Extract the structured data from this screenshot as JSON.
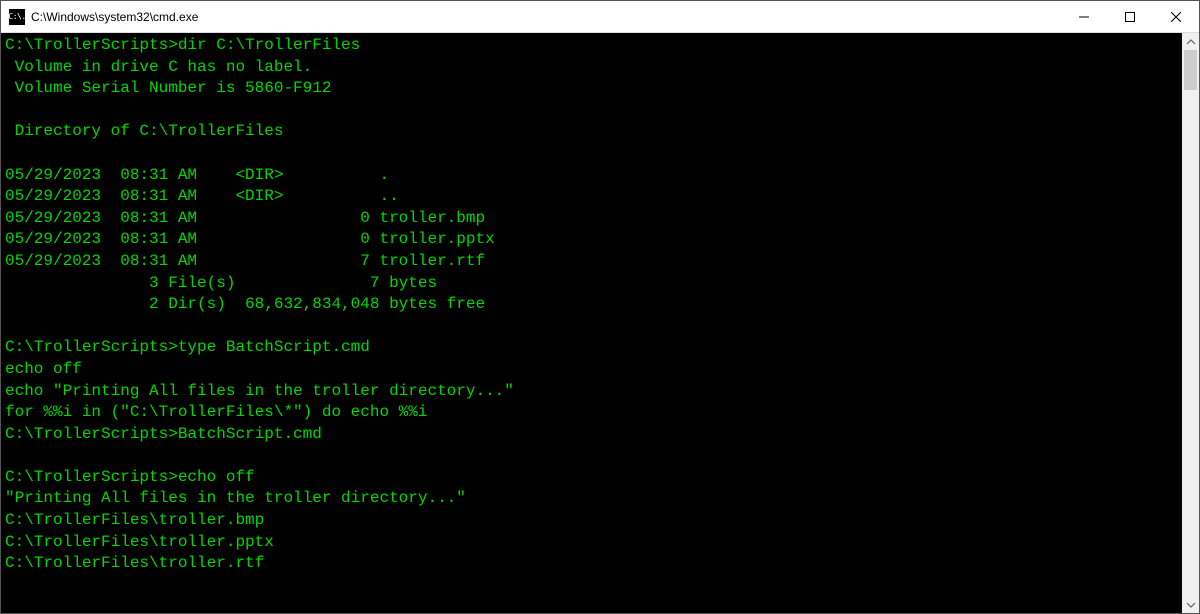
{
  "window": {
    "title": "C:\\Windows\\system32\\cmd.exe",
    "icon_text": "C:\\."
  },
  "terminal": {
    "lines": [
      "C:\\TrollerScripts>dir C:\\TrollerFiles",
      " Volume in drive C has no label.",
      " Volume Serial Number is 5860-F912",
      "",
      " Directory of C:\\TrollerFiles",
      "",
      "05/29/2023  08:31 AM    <DIR>          .",
      "05/29/2023  08:31 AM    <DIR>          ..",
      "05/29/2023  08:31 AM                 0 troller.bmp",
      "05/29/2023  08:31 AM                 0 troller.pptx",
      "05/29/2023  08:31 AM                 7 troller.rtf",
      "               3 File(s)              7 bytes",
      "               2 Dir(s)  68,632,834,048 bytes free",
      "",
      "C:\\TrollerScripts>type BatchScript.cmd",
      "echo off",
      "echo \"Printing All files in the troller directory...\"",
      "for %%i in (\"C:\\TrollerFiles\\*\") do echo %%i",
      "C:\\TrollerScripts>BatchScript.cmd",
      "",
      "C:\\TrollerScripts>echo off",
      "\"Printing All files in the troller directory...\"",
      "C:\\TrollerFiles\\troller.bmp",
      "C:\\TrollerFiles\\troller.pptx",
      "C:\\TrollerFiles\\troller.rtf"
    ]
  }
}
